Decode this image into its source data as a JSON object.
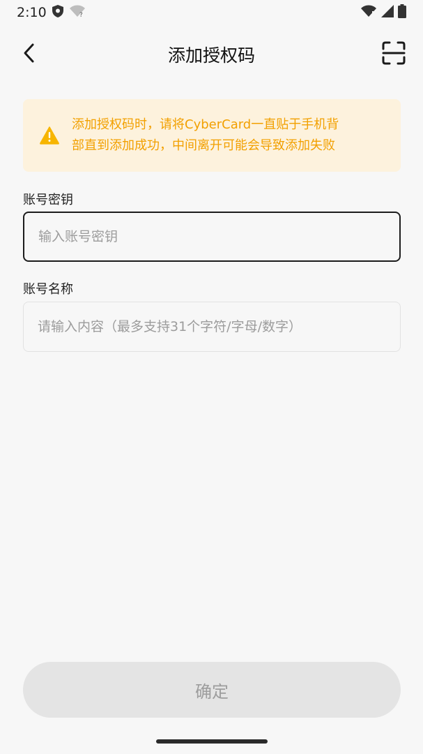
{
  "status_bar": {
    "time": "2:10",
    "icons": [
      "shield-icon",
      "wifi-question-icon",
      "wifi-alert-icon",
      "signal-icon",
      "battery-icon"
    ]
  },
  "header": {
    "title": "添加授权码",
    "back_icon": "chevron-left-icon",
    "scan_icon": "scan-icon"
  },
  "warning": {
    "icon": "warning-icon",
    "line1": "添加授权码时，请将CyberCard一直贴于手机背",
    "line2": "部直到添加成功，中间离开可能会导致添加失败",
    "color": "#f2a000",
    "background": "#fdf2dd"
  },
  "form": {
    "key_label": "账号密钥",
    "key_value": "",
    "key_placeholder": "输入账号密钥",
    "name_label": "账号名称",
    "name_value": "",
    "name_placeholder": "请输入内容（最多支持31个字符/字母/数字）"
  },
  "confirm_button": {
    "label": "确定"
  }
}
